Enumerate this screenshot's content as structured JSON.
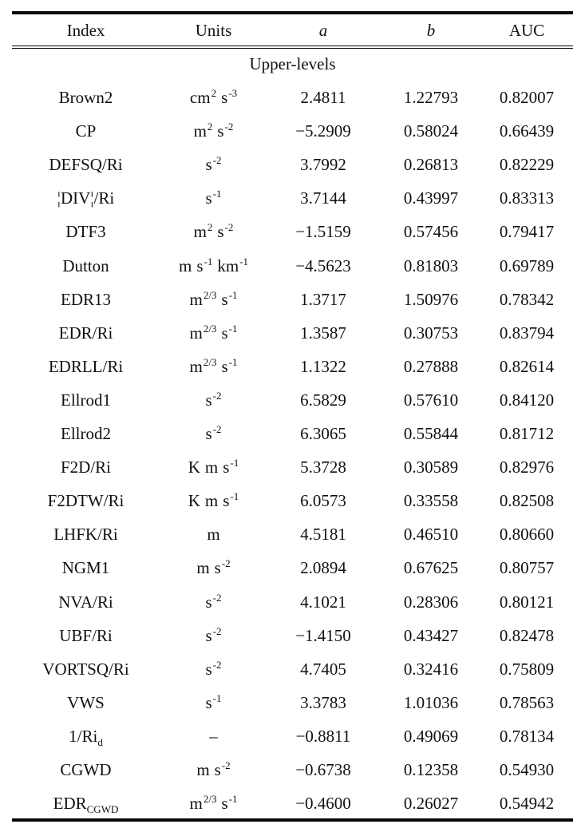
{
  "table": {
    "headers": [
      "Index",
      "Units",
      "a",
      "b",
      "AUC"
    ],
    "section_label": "Upper-levels",
    "rows": [
      {
        "index": "Brown2",
        "index_sub": "",
        "units": [
          [
            "cm",
            "2"
          ],
          [
            "s",
            "-3"
          ]
        ],
        "a": "2.4811",
        "b": "1.22793",
        "auc": "0.82007"
      },
      {
        "index": "CP",
        "index_sub": "",
        "units": [
          [
            "m",
            "2"
          ],
          [
            "s",
            "-2"
          ]
        ],
        "a": "−5.2909",
        "b": "0.58024",
        "auc": "0.66439"
      },
      {
        "index": "DEFSQ/Ri",
        "index_sub": "",
        "units": [
          [
            "s",
            "-2"
          ]
        ],
        "a": "3.7992",
        "b": "0.26813",
        "auc": "0.82229"
      },
      {
        "index": "¦DIV¦/Ri",
        "index_sub": "",
        "units": [
          [
            "s",
            "-1"
          ]
        ],
        "a": "3.7144",
        "b": "0.43997",
        "auc": "0.83313"
      },
      {
        "index": "DTF3",
        "index_sub": "",
        "units": [
          [
            "m",
            "2"
          ],
          [
            "s",
            "-2"
          ]
        ],
        "a": "−1.5159",
        "b": "0.57456",
        "auc": "0.79417"
      },
      {
        "index": "Dutton",
        "index_sub": "",
        "units": [
          [
            "m",
            ""
          ],
          [
            "s",
            "-1"
          ],
          [
            "km",
            "-1"
          ]
        ],
        "a": "−4.5623",
        "b": "0.81803",
        "auc": "0.69789"
      },
      {
        "index": "EDR13",
        "index_sub": "",
        "units": [
          [
            "m",
            "2/3"
          ],
          [
            "s",
            "-1"
          ]
        ],
        "a": "1.3717",
        "b": "1.50976",
        "auc": "0.78342"
      },
      {
        "index": "EDR/Ri",
        "index_sub": "",
        "units": [
          [
            "m",
            "2/3"
          ],
          [
            "s",
            "-1"
          ]
        ],
        "a": "1.3587",
        "b": "0.30753",
        "auc": "0.83794"
      },
      {
        "index": "EDRLL/Ri",
        "index_sub": "",
        "units": [
          [
            "m",
            "2/3"
          ],
          [
            "s",
            "-1"
          ]
        ],
        "a": "1.1322",
        "b": "0.27888",
        "auc": "0.82614"
      },
      {
        "index": "Ellrod1",
        "index_sub": "",
        "units": [
          [
            "s",
            "-2"
          ]
        ],
        "a": "6.5829",
        "b": "0.57610",
        "auc": "0.84120"
      },
      {
        "index": "Ellrod2",
        "index_sub": "",
        "units": [
          [
            "s",
            "-2"
          ]
        ],
        "a": "6.3065",
        "b": "0.55844",
        "auc": "0.81712"
      },
      {
        "index": "F2D/Ri",
        "index_sub": "",
        "units": [
          [
            "K",
            ""
          ],
          [
            "m",
            ""
          ],
          [
            "s",
            "-1"
          ]
        ],
        "a": "5.3728",
        "b": "0.30589",
        "auc": "0.82976"
      },
      {
        "index": "F2DTW/Ri",
        "index_sub": "",
        "units": [
          [
            "K",
            ""
          ],
          [
            "m",
            ""
          ],
          [
            "s",
            "-1"
          ]
        ],
        "a": "6.0573",
        "b": "0.33558",
        "auc": "0.82508"
      },
      {
        "index": "LHFK/Ri",
        "index_sub": "",
        "units": [
          [
            "m",
            ""
          ]
        ],
        "a": "4.5181",
        "b": "0.46510",
        "auc": "0.80660"
      },
      {
        "index": "NGM1",
        "index_sub": "",
        "units": [
          [
            "m",
            ""
          ],
          [
            "s",
            "-2"
          ]
        ],
        "a": "2.0894",
        "b": "0.67625",
        "auc": "0.80757"
      },
      {
        "index": "NVA/Ri",
        "index_sub": "",
        "units": [
          [
            "s",
            "-2"
          ]
        ],
        "a": "4.1021",
        "b": "0.28306",
        "auc": "0.80121"
      },
      {
        "index": "UBF/Ri",
        "index_sub": "",
        "units": [
          [
            "s",
            "-2"
          ]
        ],
        "a": "−1.4150",
        "b": "0.43427",
        "auc": "0.82478"
      },
      {
        "index": "VORTSQ/Ri",
        "index_sub": "",
        "units": [
          [
            "s",
            "-2"
          ]
        ],
        "a": "4.7405",
        "b": "0.32416",
        "auc": "0.75809"
      },
      {
        "index": "VWS",
        "index_sub": "",
        "units": [
          [
            "s",
            "-1"
          ]
        ],
        "a": "3.3783",
        "b": "1.01036",
        "auc": "0.78563"
      },
      {
        "index": "1/Ri",
        "index_sub": "d",
        "units": [
          [
            "–",
            ""
          ]
        ],
        "a": "−0.8811",
        "b": "0.49069",
        "auc": "0.78134"
      },
      {
        "index": "CGWD",
        "index_sub": "",
        "units": [
          [
            "m",
            ""
          ],
          [
            "s",
            "-2"
          ]
        ],
        "a": "−0.6738",
        "b": "0.12358",
        "auc": "0.54930"
      },
      {
        "index": "EDR",
        "index_sub": "CGWD",
        "units": [
          [
            "m",
            "2/3"
          ],
          [
            "s",
            "-1"
          ]
        ],
        "a": "−0.4600",
        "b": "0.26027",
        "auc": "0.54942"
      }
    ]
  }
}
